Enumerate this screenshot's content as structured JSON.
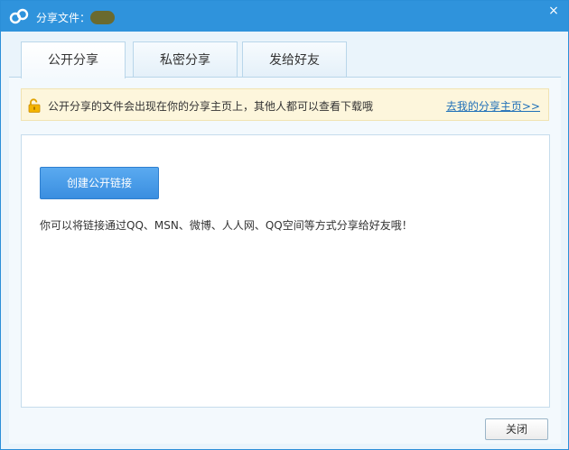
{
  "window": {
    "title": "分享文件：",
    "close_glyph": "×"
  },
  "tabs": [
    {
      "label": "公开分享",
      "active": true
    },
    {
      "label": "私密分享",
      "active": false
    },
    {
      "label": "发给好友",
      "active": false
    }
  ],
  "notice": {
    "text": "公开分享的文件会出现在你的分享主页上，其他人都可以查看下载哦",
    "link": "去我的分享主页>>"
  },
  "content": {
    "create_button": "创建公开链接",
    "hint": "你可以将链接通过QQ、MSN、微博、人人网、QQ空间等方式分享给好友哦！"
  },
  "footer": {
    "close_button": "关闭"
  },
  "icons": {
    "app": "share-app-icon",
    "lock": "unlocked-padlock-icon",
    "close": "close-icon"
  },
  "colors": {
    "titlebar": "#2f93dc",
    "primary_button": "#3a8ee0",
    "notice_bg": "#fdf6dc",
    "link": "#1f6fb8"
  }
}
